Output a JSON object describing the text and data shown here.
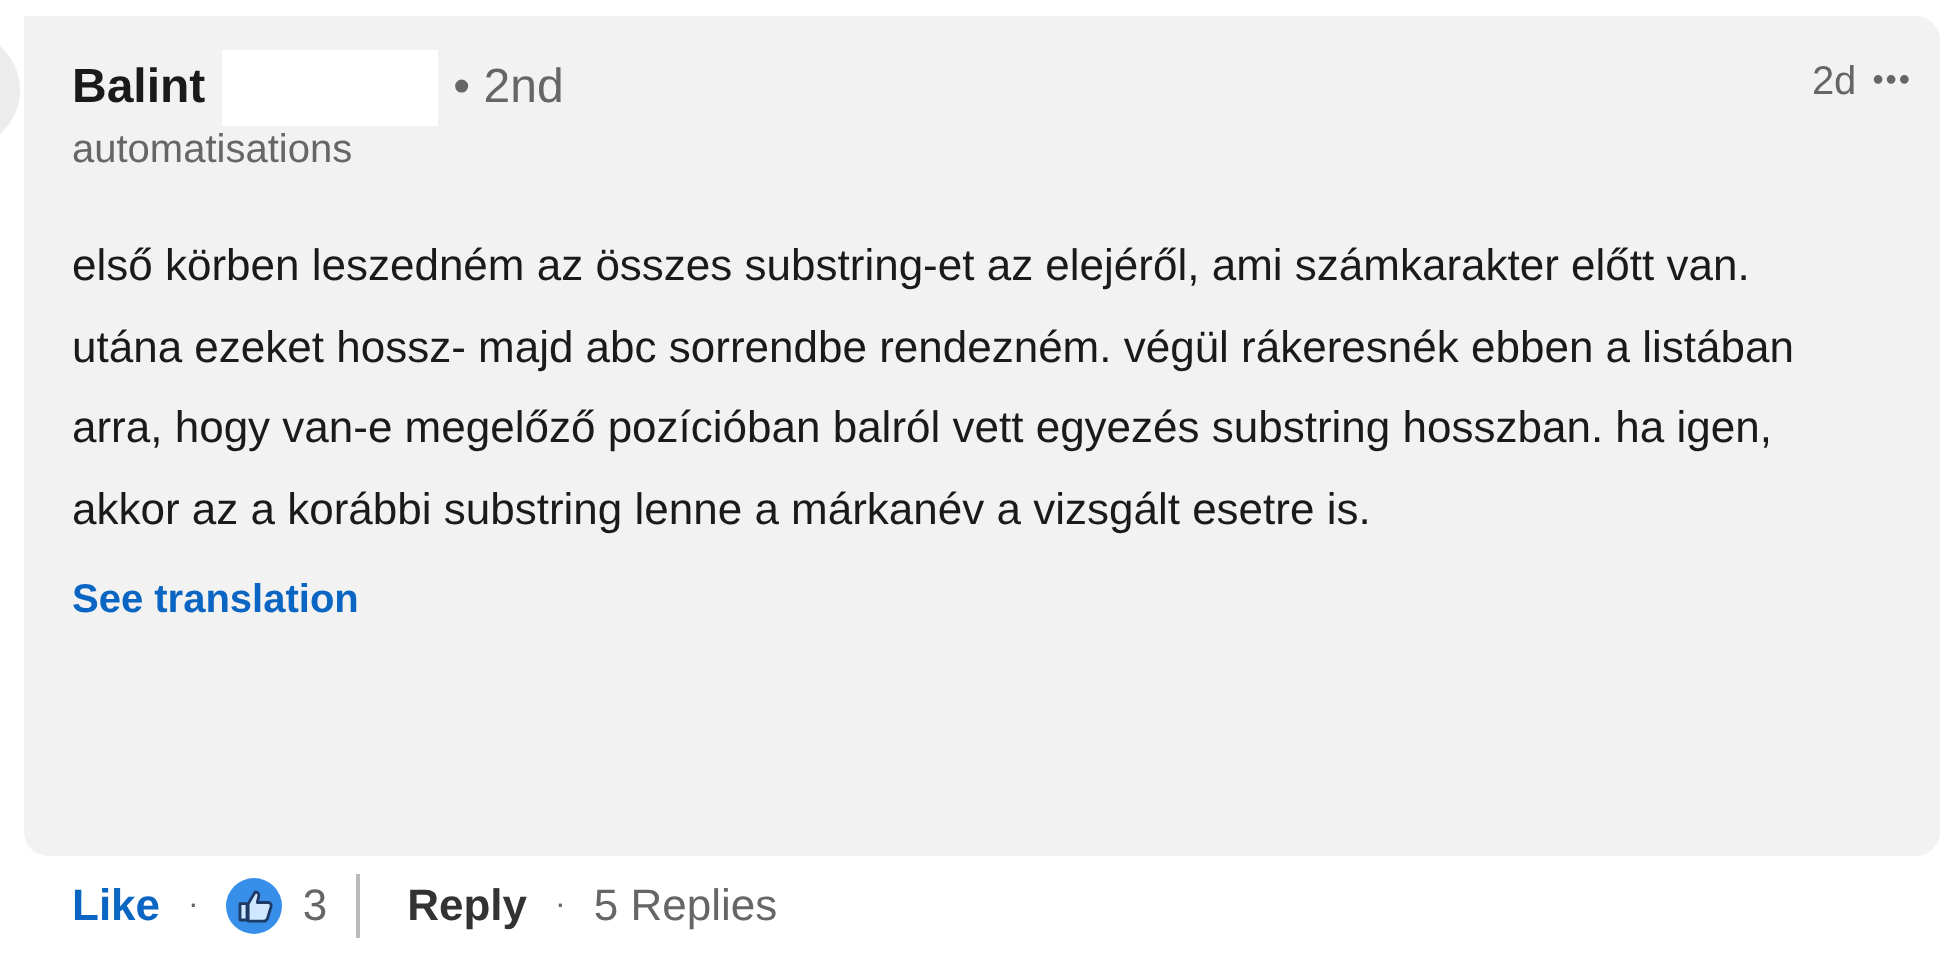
{
  "comment": {
    "author": "Balint",
    "author_redacted": true,
    "degree": "• 2nd",
    "headline": "automatisations",
    "time": "2d",
    "more": "•••",
    "text": "első körben leszedném az összes substring-et az elejéről, ami számkarakter előtt van. utána ezeket hossz- majd abc sorrendbe rendezném. végül rákeresnék ebben a listában arra, hogy van-e megelőző pozícióban balról vett egyezés substring hosszban. ha igen, akkor az a korábbi substring lenne a márkanév a vizsgált esetre is.",
    "translation_link": "See translation"
  },
  "actions": {
    "like": "Like",
    "like_sep": "·",
    "reaction_count": "3",
    "reply": "Reply",
    "replies_sep": "·",
    "replies": "5 Replies"
  }
}
